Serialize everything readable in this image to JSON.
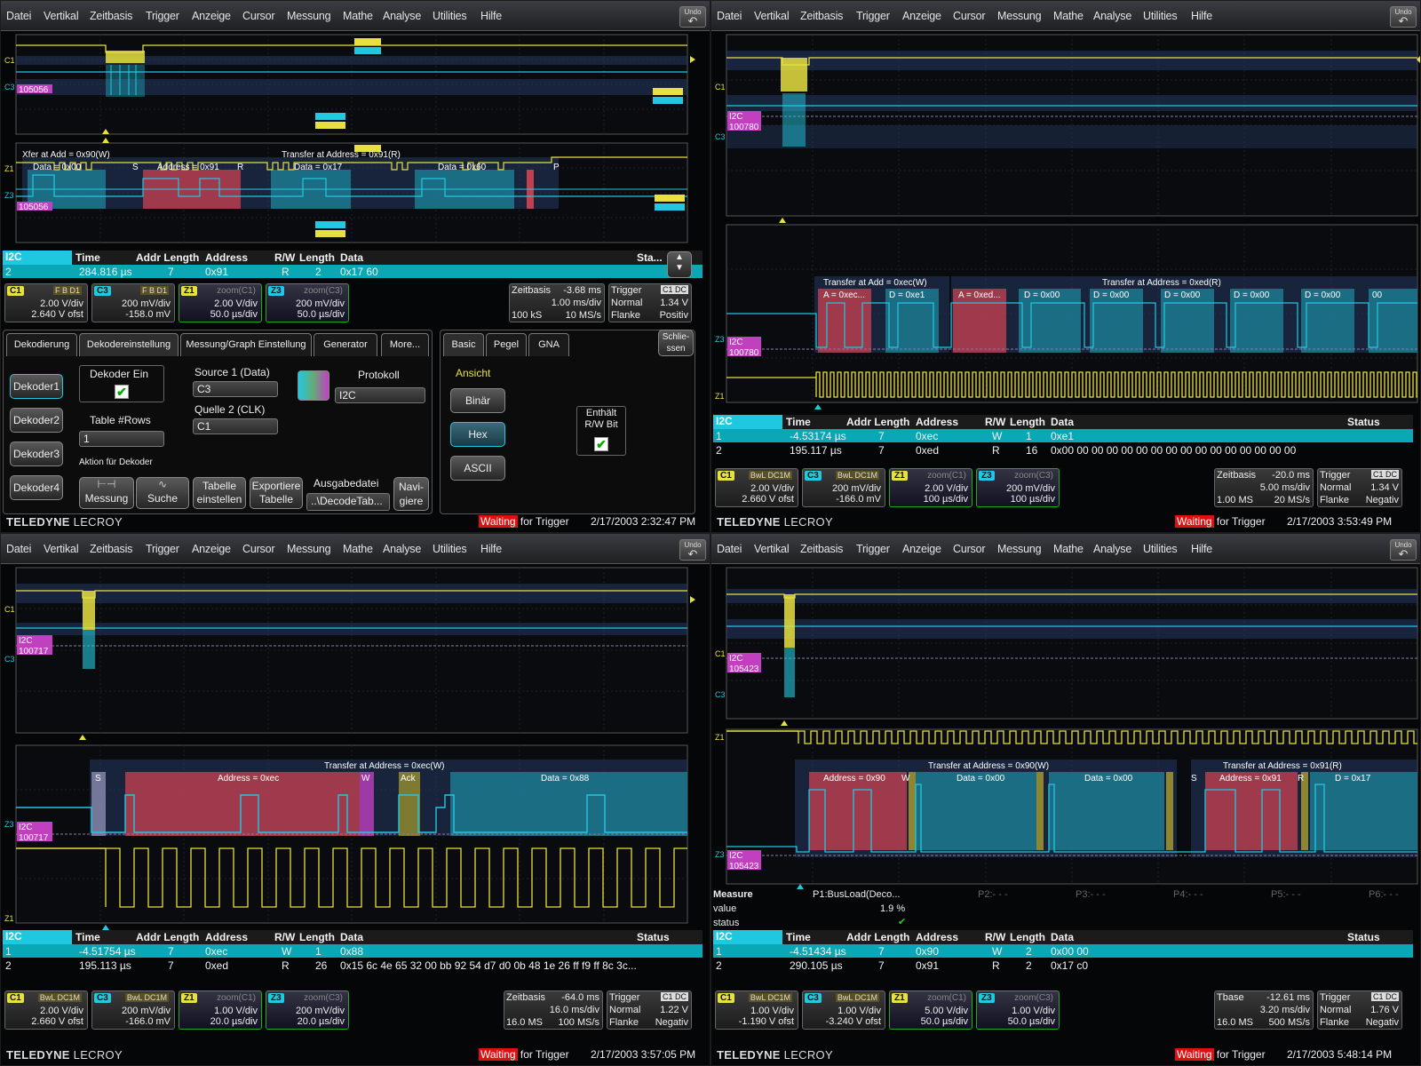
{
  "menu": [
    "Datei",
    "Vertikal",
    "Zeitbasis",
    "Trigger",
    "Anzeige",
    "Cursor",
    "Messung",
    "Mathe",
    "Analyse",
    "Utilities",
    "Hilfe"
  ],
  "undo_label": "Undo",
  "brand": {
    "name_bold": "TELEDYNE",
    "name_light": "LECROY"
  },
  "waiting": {
    "highlight": "Waiting",
    "rest": " for Trigger"
  },
  "colors": {
    "yellow": "#e8e040",
    "cyan": "#22c8e0",
    "magenta": "#c040c0",
    "red": "#c04050",
    "olive": "#9a9030",
    "teal": "#1d7f97"
  },
  "table_headers": {
    "tag": "I2C",
    "time": "Time",
    "addr_len": "Addr Length",
    "address": "Address",
    "rw": "R/W",
    "length": "Length",
    "data": "Data",
    "status": "Status"
  },
  "panes": [
    {
      "id": "tl",
      "timestamp": "2/17/2003 2:32:47 PM",
      "table": {
        "status_header": "Sta...",
        "rows": [
          [
            "2",
            "284.816 µs",
            "7",
            "0x91",
            "R",
            "2",
            "0x17 60"
          ]
        ]
      },
      "trace_labels": {
        "c1": "C1",
        "c3": "C3",
        "z1": "Z1",
        "z3": "Z3",
        "i2c": "I2C",
        "count": "105056",
        "xfer1": "Xfer at Add = 0x90(W)",
        "xfer2": "Transfer at Address = 0x91(R)",
        "seg_data1": "Data = 0x00",
        "seg_addr": "Address = 0x91",
        "seg_data2": "Data = 0x17",
        "seg_data3": "Data = 0x60",
        "s": "S",
        "r": "R",
        "p": "P"
      },
      "channels": [
        {
          "tag": "C1",
          "badges": "F B D1",
          "l1": "2.00 V/div",
          "l2": "2.640 V ofst"
        },
        {
          "tag": "C3",
          "badges": "F B D1",
          "l1": "200 mV/div",
          "l2": "-158.0 mV"
        },
        {
          "tag": "Z1",
          "zoom": "zoom(C1)",
          "l1": "2.00 V/div",
          "l2": "50.0 µs/div"
        },
        {
          "tag": "Z3",
          "zoom": "zoom(C3)",
          "l1": "200 mV/div",
          "l2": "50.0 µs/div"
        }
      ],
      "timebase": {
        "label": "Zeitbasis",
        "offset": "-3.68 ms",
        "per_div": "1.00 ms/div",
        "samples": "100 kS",
        "rate": "10 MS/s"
      },
      "trigger": {
        "label": "Trigger",
        "src": "C1 DC",
        "mode": "Normal",
        "level": "1.34 V",
        "type": "Flanke",
        "slope": "Positiv"
      },
      "dialog": {
        "tabs": [
          "Dekodierung",
          "Dekodereinstellung",
          "Messung/Graph Einstellung",
          "Generator",
          "More..."
        ],
        "decoders": [
          "Dekoder1",
          "Dekoder2",
          "Dekoder3",
          "Dekoder4"
        ],
        "decoder_on": "Dekoder Ein",
        "table_rows_label": "Table #Rows",
        "table_rows_value": "1",
        "source1_label": "Source 1 (Data)",
        "source1_value": "C3",
        "source2_label": "Quelle 2 (CLK)",
        "source2_value": "C1",
        "protocol_label": "Protokoll",
        "protocol_value": "I2C",
        "action_label": "Aktion für Dekoder",
        "actions": [
          "Messung",
          "Suche",
          "Tabelle einstellen",
          "Exportiere Tabelle"
        ],
        "output_label": "Ausgabedatei",
        "output_value": "..\\DecodeTab...",
        "navigate": "Navi-giere",
        "right_tabs": [
          "Basic",
          "Pegel",
          "GNA"
        ],
        "close": "Schlie-ssen",
        "view_label": "Ansicht",
        "view_buttons": [
          "Binär",
          "Hex",
          "ASCII"
        ],
        "rw_bit": "Enthält R/W Bit"
      }
    },
    {
      "id": "tr",
      "timestamp": "2/17/2003 3:53:49 PM",
      "table": {
        "rows": [
          [
            "1",
            "-4.53174 µs",
            "7",
            "0xec",
            "W",
            "1",
            "0xe1"
          ],
          [
            "2",
            "195.117 µs",
            "7",
            "0xed",
            "R",
            "16",
            "0x00 00 00 00 00 00 00 00 00 00 00 00 00 00 00 00"
          ]
        ]
      },
      "trace_labels": {
        "c1": "C1",
        "c3": "C3",
        "z1": "Z1",
        "z3": "Z3",
        "i2c": "I2C",
        "count": "100780",
        "xfer1": "Transfer at Add = 0xec(W)",
        "xfer2": "Transfer at Address = 0xed(R)",
        "segs": [
          "A = 0xec...",
          "D = 0xe1",
          "A = 0xed...",
          "D = 0x00",
          "D = 0x00",
          "D = 0x00",
          "D = 0x00",
          "D = 0x00",
          "00"
        ]
      },
      "channels": [
        {
          "tag": "C1",
          "badges": "BwL DC1M",
          "l1": "2.00 V/div",
          "l2": "2.660 V ofst"
        },
        {
          "tag": "C3",
          "badges": "BwL DC1M",
          "l1": "200 mV/div",
          "l2": "-166.0 mV"
        },
        {
          "tag": "Z1",
          "zoom": "zoom(C1)",
          "l1": "2.00 V/div",
          "l2": "100 µs/div"
        },
        {
          "tag": "Z3",
          "zoom": "zoom(C3)",
          "l1": "200 mV/div",
          "l2": "100 µs/div"
        }
      ],
      "timebase": {
        "label": "Zeitbasis",
        "offset": "-20.0 ms",
        "per_div": "5.00 ms/div",
        "samples": "1.00 MS",
        "rate": "20 MS/s"
      },
      "trigger": {
        "label": "Trigger",
        "src": "C1 DC",
        "mode": "Normal",
        "level": "1.34 V",
        "type": "Flanke",
        "slope": "Negativ"
      }
    },
    {
      "id": "bl",
      "timestamp": "2/17/2003 3:57:05 PM",
      "table": {
        "rows": [
          [
            "1",
            "-4.51754 µs",
            "7",
            "0xec",
            "W",
            "1",
            "0x88"
          ],
          [
            "2",
            "195.113 µs",
            "7",
            "0xed",
            "R",
            "26",
            "0x15 6c 4e 65 32 00 bb 92 54 d7 d0 0b 48 1e 26 ff f9 ff 8c 3c..."
          ]
        ]
      },
      "trace_labels": {
        "c1": "C1",
        "c3": "C3",
        "z1": "Z1",
        "z3": "Z3",
        "i2c": "I2C",
        "count": "100717",
        "xfer1": "Transfer at Address = 0xec(W)",
        "seg_addr": "Address = 0xec",
        "seg_data": "Data = 0x88",
        "s": "S",
        "w": "W",
        "ack": "Ack"
      },
      "channels": [
        {
          "tag": "C1",
          "badges": "BwL DC1M",
          "l1": "2.00 V/div",
          "l2": "2.660 V ofst"
        },
        {
          "tag": "C3",
          "badges": "BwL DC1M",
          "l1": "200 mV/div",
          "l2": "-166.0 mV"
        },
        {
          "tag": "Z1",
          "zoom": "zoom(C1)",
          "l1": "1.00 V/div",
          "l2": "20.0 µs/div"
        },
        {
          "tag": "Z3",
          "zoom": "zoom(C3)",
          "l1": "200 mV/div",
          "l2": "20.0 µs/div"
        }
      ],
      "timebase": {
        "label": "Zeitbasis",
        "offset": "-64.0 ms",
        "per_div": "16.0 ms/div",
        "samples": "16.0 MS",
        "rate": "100 MS/s"
      },
      "trigger": {
        "label": "Trigger",
        "src": "C1 DC",
        "mode": "Normal",
        "level": "1.22 V",
        "type": "Flanke",
        "slope": "Negativ"
      }
    },
    {
      "id": "br",
      "timestamp": "2/17/2003 5:48:14 PM",
      "table": {
        "rows": [
          [
            "1",
            "-4.51434 µs",
            "7",
            "0x90",
            "W",
            "2",
            "0x00 00"
          ],
          [
            "2",
            "290.105 µs",
            "7",
            "0x91",
            "R",
            "2",
            "0x17 c0"
          ]
        ]
      },
      "trace_labels": {
        "c1": "C1",
        "c3": "C3",
        "z1": "Z1",
        "z3": "Z3",
        "i2c": "I2C",
        "count": "105423",
        "xfer1": "Transfer at Address = 0x90(W)",
        "xfer2": "Transfer at Address = 0x91(R)",
        "seg_addr1": "Address = 0x90",
        "seg_d1": "Data = 0x00",
        "seg_d2": "Data = 0x00",
        "seg_addr2": "Address = 0x91",
        "seg_d3": "D = 0x17",
        "w": "W",
        "r": "R",
        "s": "S"
      },
      "measure": {
        "label": "Measure",
        "value_label": "value",
        "status_label": "status",
        "p1": "P1:BusLoad(Deco...",
        "p1_value": "1.9 %",
        "p2": "P2:- - -",
        "p3": "P3:- - -",
        "p4": "P4:- - -",
        "p5": "P5:- - -",
        "p6": "P6:- - -"
      },
      "channels": [
        {
          "tag": "C1",
          "badges": "BwL DC1M",
          "l1": "1.00 V/div",
          "l2": "-1.190 V ofst"
        },
        {
          "tag": "C3",
          "badges": "BwL DC1M",
          "l1": "1.00 V/div",
          "l2": "-3.240 V ofst"
        },
        {
          "tag": "Z1",
          "zoom": "zoom(C1)",
          "l1": "5.00 V/div",
          "l2": "50.0 µs/div"
        },
        {
          "tag": "Z3",
          "zoom": "zoom(C3)",
          "l1": "1.00 V/div",
          "l2": "50.0 µs/div"
        }
      ],
      "timebase": {
        "label": "Tbase",
        "offset": "-12.61 ms",
        "per_div": "3.20 ms/div",
        "samples": "16.0 MS",
        "rate": "500 MS/s"
      },
      "trigger": {
        "label": "Trigger",
        "src": "C1 DC",
        "mode": "Normal",
        "level": "1.76 V",
        "type": "Flanke",
        "slope": "Negativ"
      }
    }
  ]
}
